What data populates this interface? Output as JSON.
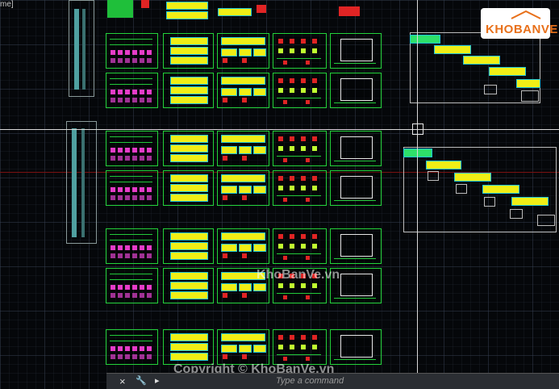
{
  "viewport": {
    "label": "me]"
  },
  "watermarks": [
    "KhoBanVe.vn",
    "Copyright © KhoBanVe.vn"
  ],
  "logo": {
    "text": "KHOBANVE"
  },
  "command_line": {
    "close_icon": "×",
    "wrench_icon": "🔧",
    "placeholder": "Type a command"
  },
  "colors": {
    "background": "#05070a",
    "sheet_border": "#23d23a",
    "fill_yellow": "#f0ee16",
    "accent_cyan": "#1ec4d6",
    "accent_pink": "#e63cc8"
  }
}
